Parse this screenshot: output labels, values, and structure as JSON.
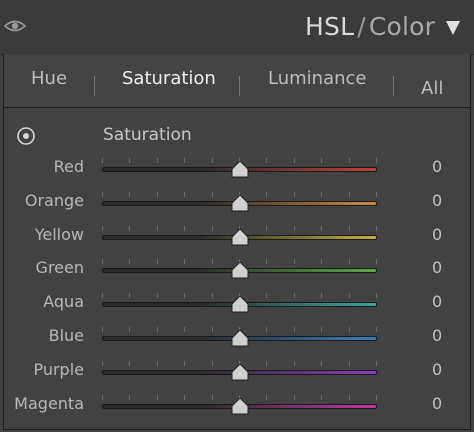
{
  "header": {
    "title_main": "HSL",
    "title_sep": "/",
    "title_alt": "Color"
  },
  "tabs": [
    {
      "label": "Hue"
    },
    {
      "label": "Saturation"
    },
    {
      "label": "Luminance"
    },
    {
      "label": "All"
    }
  ],
  "section": {
    "label": "Saturation"
  },
  "sliders": [
    {
      "label": "Red",
      "value": "0",
      "level": 0,
      "color": "#c04040"
    },
    {
      "label": "Orange",
      "value": "0",
      "level": 0,
      "color": "#c98a3e"
    },
    {
      "label": "Yellow",
      "value": "0",
      "level": 0,
      "color": "#c0b23c"
    },
    {
      "label": "Green",
      "value": "0",
      "level": 0,
      "color": "#5fa64a"
    },
    {
      "label": "Aqua",
      "value": "0",
      "level": 0,
      "color": "#3aa6a0"
    },
    {
      "label": "Blue",
      "value": "0",
      "level": 0,
      "color": "#3a7fc2"
    },
    {
      "label": "Purple",
      "value": "0",
      "level": 0,
      "color": "#8a3fc0"
    },
    {
      "label": "Magenta",
      "value": "0",
      "level": 0,
      "color": "#c03a9e"
    }
  ],
  "icons": {
    "visibility": "eye-icon",
    "collapse": "triangle-down-icon",
    "targeted_adjustment": "target-icon",
    "thumb": "slider-thumb-icon"
  },
  "colors": {
    "track_left": "#2a2a2a",
    "thumb": "#cfcfcf"
  }
}
